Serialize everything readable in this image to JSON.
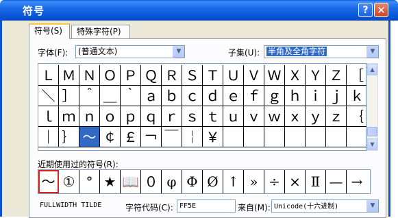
{
  "window": {
    "title": "符号",
    "help_label": "?",
    "close_label": "✕"
  },
  "tabs": [
    {
      "label": "符号(S)"
    },
    {
      "label": "特殊字符(P)"
    }
  ],
  "font": {
    "label": "字体(F):",
    "value": "(普通文本)"
  },
  "subset": {
    "label": "子集(U):",
    "value": "半角及全角字符"
  },
  "symbols": [
    [
      "Ｌ",
      "Ｍ",
      "Ｎ",
      "Ｏ",
      "Ｐ",
      "Ｑ",
      "Ｒ",
      "Ｓ",
      "Ｔ",
      "Ｕ",
      "Ｖ",
      "Ｗ",
      "Ｘ",
      "Ｙ",
      "Ｚ",
      "［"
    ],
    [
      "＼",
      "］",
      "＾",
      "＿",
      "｀",
      "ａ",
      "ｂ",
      "ｃ",
      "ｄ",
      "ｅ",
      "ｆ",
      "ｇ",
      "ｈ",
      "ｉ",
      "ｊ",
      "ｋ"
    ],
    [
      "ｌ",
      "ｍ",
      "ｎ",
      "ｏ",
      "ｐ",
      "ｑ",
      "ｒ",
      "ｓ",
      "ｔ",
      "ｕ",
      "ｖ",
      "ｗ",
      "ｘ",
      "ｙ",
      "ｚ",
      "｛"
    ],
    [
      "｜",
      "｝",
      "～",
      "￠",
      "￡",
      "￢",
      "￣",
      "￤",
      "￥",
      "",
      "",
      "",
      "",
      "",
      "",
      ""
    ]
  ],
  "selected_symbol": "～",
  "recent": {
    "label": "近期使用过的符号(R):",
    "items": [
      "～",
      "①",
      "°",
      "★",
      "📖",
      "０",
      "φ",
      "Φ",
      "Ø",
      "↑",
      "»",
      "÷",
      "×",
      "Ⅱ",
      "—",
      "→"
    ]
  },
  "status": {
    "unicode_name": "FULLWIDTH TILDE",
    "code_label": "字符代码(C):",
    "code_value": "FF5E",
    "from_label": "来自(M):",
    "from_value": "Unicode(十六进制)"
  },
  "colors": {
    "title_bar": "#0a58e0",
    "selection": "#316ac5",
    "dialog_bg": "#ece9d8"
  }
}
